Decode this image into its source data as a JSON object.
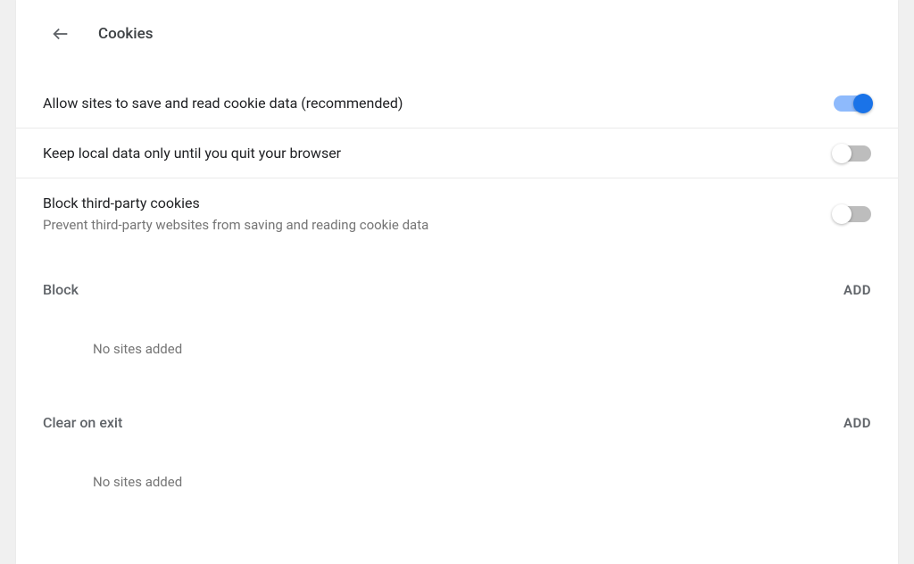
{
  "header": {
    "title": "Cookies"
  },
  "settings": [
    {
      "title": "Allow sites to save and read cookie data (recommended)",
      "sub": null,
      "on": true
    },
    {
      "title": "Keep local data only until you quit your browser",
      "sub": null,
      "on": false
    },
    {
      "title": "Block third-party cookies",
      "sub": "Prevent third-party websites from saving and reading cookie data",
      "on": false
    }
  ],
  "sections": [
    {
      "title": "Block",
      "add_label": "ADD",
      "empty_text": "No sites added"
    },
    {
      "title": "Clear on exit",
      "add_label": "ADD",
      "empty_text": "No sites added"
    }
  ]
}
